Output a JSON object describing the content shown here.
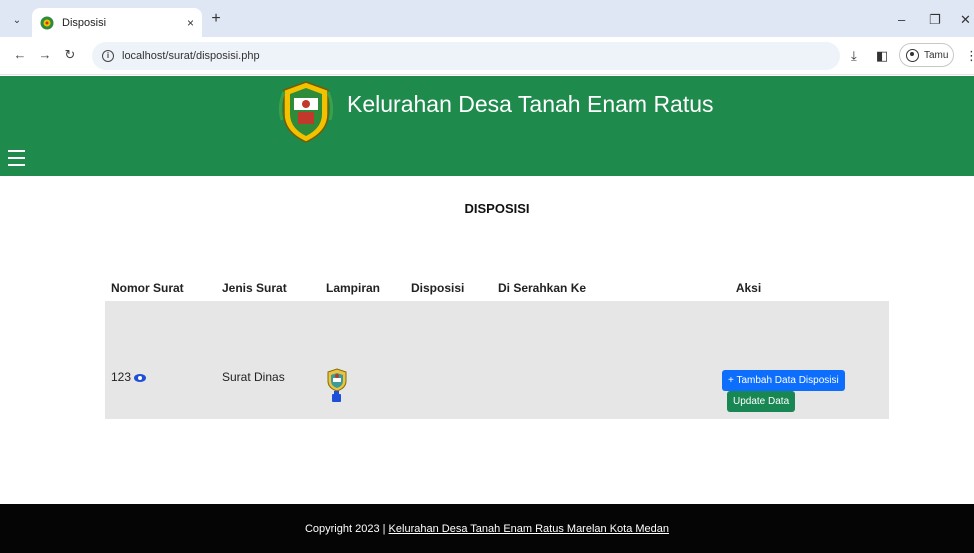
{
  "browser": {
    "tab_title": "Disposisi",
    "tab_close": "×",
    "new_tab": "+",
    "url": "localhost/surat/disposisi.php",
    "profile_label": "Tamu",
    "icons": [
      "tab-search-icon",
      "back-icon",
      "forward-icon",
      "reload-icon",
      "info-icon",
      "download-icon",
      "side-panel-icon",
      "profile-icon",
      "kebab-menu-icon",
      "minimize-icon",
      "restore-icon",
      "close-icon"
    ]
  },
  "header": {
    "title": "Kelurahan Desa Tanah Enam Ratus",
    "background": "#1e8a4c"
  },
  "main": {
    "heading": "DISPOSISI",
    "columns": [
      "Nomor Surat",
      "Jenis Surat",
      "Lampiran",
      "Disposisi",
      "Di Serahkan Ke",
      "Aksi"
    ],
    "rows": [
      {
        "nomor_surat": "123",
        "jenis_surat": "Surat Dinas",
        "disposisi": "",
        "diserahkan_ke": "",
        "add_button": "+ Tambah Data Disposisi",
        "update_button": "Update Data"
      }
    ]
  },
  "footer": {
    "prefix": "Copyright 2023 | ",
    "link_text": "Kelurahan Desa Tanah Enam Ratus Marelan Kota Medan"
  },
  "colors": {
    "primary_button": "#0d6efd",
    "success_button": "#198754",
    "footer": "#050505"
  }
}
